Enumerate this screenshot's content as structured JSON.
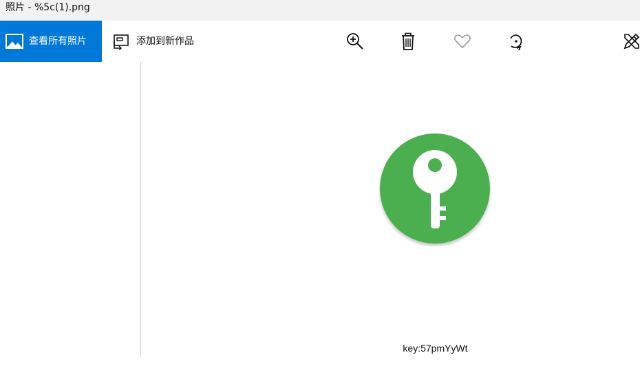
{
  "window": {
    "title": "照片 - %5c(1).png"
  },
  "toolbar": {
    "view_all_label": "查看所有照片",
    "add_to_creation_label": "添加到新作品",
    "tools": [
      {
        "name": "zoom-in",
        "icon": "zoom-in-icon"
      },
      {
        "name": "delete",
        "icon": "trash-icon"
      },
      {
        "name": "favorite",
        "icon": "heart-icon"
      },
      {
        "name": "rotate",
        "icon": "rotate-icon"
      },
      {
        "name": "edit",
        "icon": "edit-pencil-icon"
      }
    ]
  },
  "image": {
    "icon": "key-icon",
    "circle_color": "#4caf50",
    "key_color": "#ffffff",
    "caption": "key:57pmYyWt"
  },
  "colors": {
    "accent": "#0078d7",
    "titlebar_bg": "#f2f2f2"
  }
}
